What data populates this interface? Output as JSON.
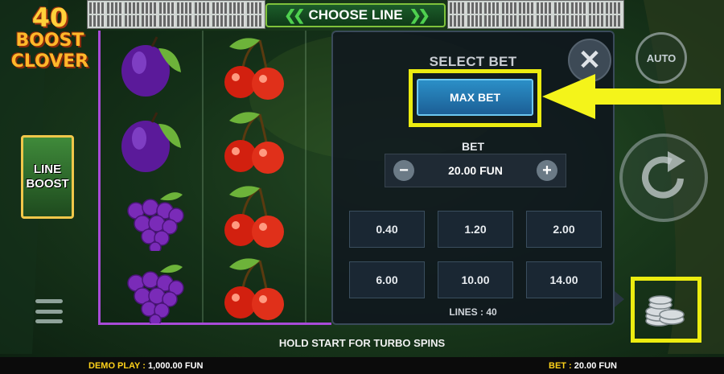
{
  "logo": {
    "number": "40",
    "word1": "BOOST",
    "word2": "CLOVER"
  },
  "header": {
    "choose_line_label": "CHOOSE LINE"
  },
  "feature": {
    "line_boost_1": "LINE",
    "line_boost_2": "BOOST"
  },
  "bet_panel": {
    "title": "SELECT BET",
    "close_symbol": "✕",
    "max_bet_label": "MAX BET",
    "bet_label": "BET",
    "current_bet": "20.00 FUN",
    "minus_symbol": "−",
    "plus_symbol": "+",
    "options": [
      "0.40",
      "1.20",
      "2.00",
      "6.00",
      "10.00",
      "14.00"
    ],
    "lines_text": "LINES : 40"
  },
  "controls": {
    "auto_label": "AUTO"
  },
  "messages": {
    "turbo_hint": "HOLD START FOR TURBO SPINS"
  },
  "status_bar": {
    "demo_label": "DEMO PLAY :",
    "demo_value": "1,000.00 FUN",
    "bet_label": "BET :",
    "bet_value": "20.00 FUN"
  },
  "reels": {
    "col1": [
      "plum",
      "plum",
      "grapes",
      "grapes"
    ],
    "col2": [
      "cherries",
      "cherries",
      "cherries",
      "cherries"
    ]
  },
  "colors": {
    "highlight": "#ecec10",
    "reel_border": "#a84bd8",
    "max_bet": "#1c6fa8"
  }
}
